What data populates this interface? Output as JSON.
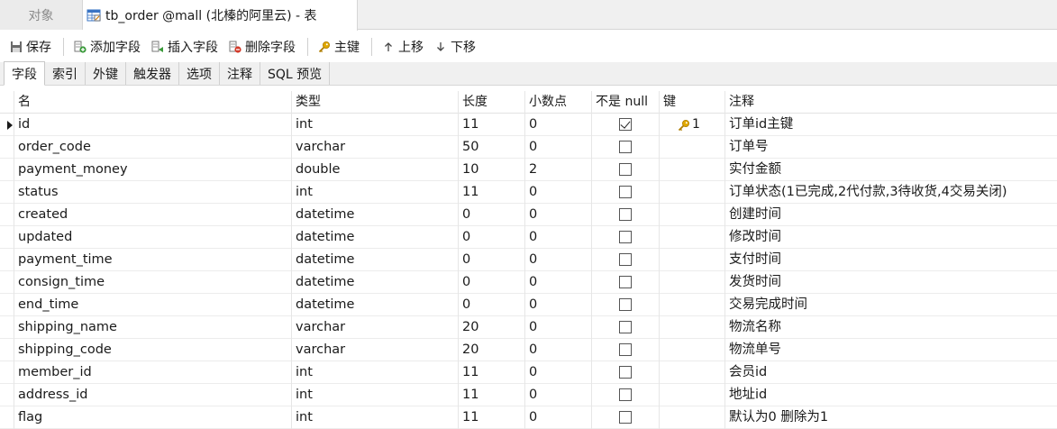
{
  "tabs": {
    "objects": "对象",
    "table": "tb_order @mall (北榛的阿里云) - 表"
  },
  "toolbar": {
    "save": "保存",
    "add_field": "添加字段",
    "insert_field": "插入字段",
    "delete_field": "删除字段",
    "primary_key": "主键",
    "move_up": "上移",
    "move_down": "下移"
  },
  "subtabs": [
    "字段",
    "索引",
    "外键",
    "触发器",
    "选项",
    "注释",
    "SQL 预览"
  ],
  "columns": {
    "name": "名",
    "type": "类型",
    "length": "长度",
    "decimals": "小数点",
    "not_null": "不是 null",
    "key": "键",
    "comment": "注释"
  },
  "rows": [
    {
      "name": "id",
      "type": "int",
      "length": "11",
      "decimals": "0",
      "not_null": true,
      "key": "1",
      "comment": "订单id主键"
    },
    {
      "name": "order_code",
      "type": "varchar",
      "length": "50",
      "decimals": "0",
      "not_null": false,
      "key": "",
      "comment": "订单号"
    },
    {
      "name": "payment_money",
      "type": "double",
      "length": "10",
      "decimals": "2",
      "not_null": false,
      "key": "",
      "comment": "实付金额"
    },
    {
      "name": "status",
      "type": "int",
      "length": "11",
      "decimals": "0",
      "not_null": false,
      "key": "",
      "comment": "订单状态(1已完成,2代付款,3待收货,4交易关闭)"
    },
    {
      "name": "created",
      "type": "datetime",
      "length": "0",
      "decimals": "0",
      "not_null": false,
      "key": "",
      "comment": "创建时间"
    },
    {
      "name": "updated",
      "type": "datetime",
      "length": "0",
      "decimals": "0",
      "not_null": false,
      "key": "",
      "comment": "修改时间"
    },
    {
      "name": "payment_time",
      "type": "datetime",
      "length": "0",
      "decimals": "0",
      "not_null": false,
      "key": "",
      "comment": "支付时间"
    },
    {
      "name": "consign_time",
      "type": "datetime",
      "length": "0",
      "decimals": "0",
      "not_null": false,
      "key": "",
      "comment": "发货时间"
    },
    {
      "name": "end_time",
      "type": "datetime",
      "length": "0",
      "decimals": "0",
      "not_null": false,
      "key": "",
      "comment": "交易完成时间"
    },
    {
      "name": "shipping_name",
      "type": "varchar",
      "length": "20",
      "decimals": "0",
      "not_null": false,
      "key": "",
      "comment": "物流名称"
    },
    {
      "name": "shipping_code",
      "type": "varchar",
      "length": "20",
      "decimals": "0",
      "not_null": false,
      "key": "",
      "comment": "物流单号"
    },
    {
      "name": "member_id",
      "type": "int",
      "length": "11",
      "decimals": "0",
      "not_null": false,
      "key": "",
      "comment": "会员id"
    },
    {
      "name": "address_id",
      "type": "int",
      "length": "11",
      "decimals": "0",
      "not_null": false,
      "key": "",
      "comment": "地址id"
    },
    {
      "name": "flag",
      "type": "int",
      "length": "11",
      "decimals": "0",
      "not_null": false,
      "key": "",
      "comment": "默认为0  删除为1"
    }
  ],
  "icons": {
    "table_tab": "table-icon",
    "save": "save-icon",
    "add_field": "add-field-icon",
    "insert_field": "insert-field-icon",
    "delete_field": "delete-field-icon",
    "primary_key": "key-icon",
    "move_up": "arrow-up-icon",
    "move_down": "arrow-down-icon"
  },
  "colors": {
    "key_gold": "#e0a800",
    "add_green": "#3a9a3a",
    "delete_red": "#d23a2a",
    "tab_bg": "#f0f0f0"
  }
}
